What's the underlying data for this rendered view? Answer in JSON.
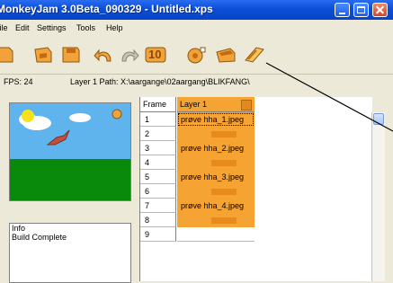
{
  "window": {
    "title": "MonkeyJam 3.0Beta_090329 - Untitled.xps"
  },
  "menu": {
    "items": [
      "File",
      "Edit",
      "Settings",
      "Tools",
      "Help"
    ]
  },
  "toolbar": {
    "icons": [
      "new-file-icon",
      "open-file-icon",
      "save-file-icon",
      "undo-icon",
      "redo-icon",
      "ten-frames-icon",
      "capture-icon",
      "camera-icon",
      "import-icon"
    ],
    "ten_label": "10"
  },
  "status": {
    "fps": "FPS: 24",
    "layer_path": "Layer 1 Path: X:\\aargange\\02aargang\\BLIKFANG\\"
  },
  "info": {
    "heading": "Info",
    "message": "Build Complete"
  },
  "grid": {
    "frame_header": "Frame",
    "layer_header": "Layer 1",
    "frames": [
      "1",
      "2",
      "3",
      "4",
      "5",
      "6",
      "7",
      "8",
      "9"
    ],
    "cells": [
      {
        "type": "image",
        "text": "prøve hha_1.jpeg",
        "selected": true
      },
      {
        "type": "hold"
      },
      {
        "type": "image",
        "text": "prøve hha_2.jpeg"
      },
      {
        "type": "hold"
      },
      {
        "type": "image",
        "text": "prøve hha_3.jpeg"
      },
      {
        "type": "hold"
      },
      {
        "type": "image",
        "text": "prøve hha_4.jpeg"
      },
      {
        "type": "hold"
      },
      {
        "type": "empty"
      }
    ]
  },
  "colors": {
    "titlebar": "#0a4fd8",
    "layer_orange": "#f5a433",
    "hold_bar": "#e68a1a",
    "window_bg": "#ece9d8"
  }
}
